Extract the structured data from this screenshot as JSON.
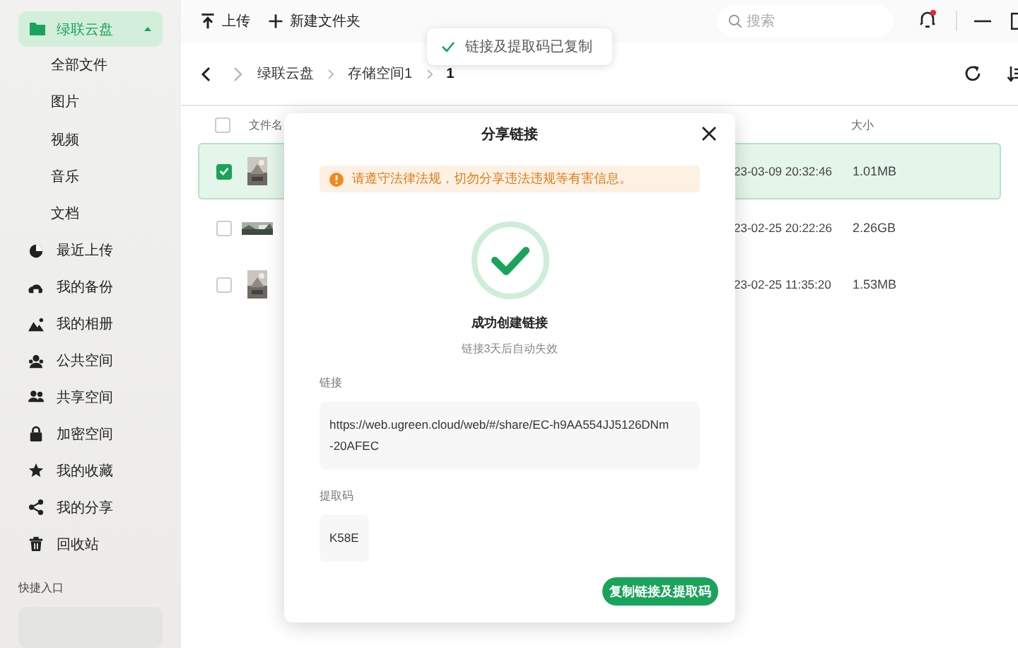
{
  "sidebar": {
    "items": [
      {
        "label": "绿联云盘",
        "kind": "group",
        "selected": true,
        "expanded": true,
        "children": [
          {
            "label": "全部文件",
            "selected": false
          },
          {
            "label": "图片",
            "selected": false
          },
          {
            "label": "视频",
            "selected": false
          },
          {
            "label": "音乐",
            "selected": false
          },
          {
            "label": "文档",
            "selected": false
          }
        ]
      },
      {
        "label": "最近上传",
        "kind": "item",
        "selected": false
      },
      {
        "label": "我的备份",
        "kind": "item",
        "selected": false
      },
      {
        "label": "我的相册",
        "kind": "item",
        "selected": false
      },
      {
        "label": "公共空间",
        "kind": "item",
        "selected": false
      },
      {
        "label": "共享空间",
        "kind": "item",
        "selected": false
      },
      {
        "label": "加密空间",
        "kind": "item",
        "selected": false
      },
      {
        "label": "我的收藏",
        "kind": "item",
        "selected": false
      },
      {
        "label": "我的分享",
        "kind": "item",
        "selected": false
      },
      {
        "label": "回收站",
        "kind": "item",
        "selected": false
      }
    ],
    "quick_access": {
      "title": "快捷入口"
    }
  },
  "toolbar": {
    "buttons": [
      {
        "label": "上传"
      },
      {
        "label": "新建文件夹"
      }
    ],
    "search": {
      "placeholder": "搜索"
    },
    "notifications": {
      "unread": true
    }
  },
  "breadcrumb": [
    "绿联云盘",
    "存储空间1",
    "1"
  ],
  "table": {
    "header": {
      "checked": false,
      "name": "文件名",
      "size": "大小"
    },
    "rows": [
      {
        "selected": true,
        "checked": true,
        "date": "23-03-09 20:32:46",
        "size": "1.01MB"
      },
      {
        "selected": false,
        "checked": false,
        "date": "23-02-25 20:22:26",
        "size": "2.26GB"
      },
      {
        "selected": false,
        "checked": false,
        "date": "23-02-25 11:35:20",
        "size": "1.53MB"
      }
    ]
  },
  "toast": "链接及提取码已复制",
  "dialog": {
    "title": "分享链接",
    "warning": "请遵守法律法规，切勿分享违法违规等有害信息。",
    "success_title": "成功创建链接",
    "success_subtitle": "链接3天后自动失效",
    "link_label": "链接",
    "link": "https://web.ugreen.cloud/web/#/share/EC-h9AA554JJ5126DNm\n-20AFEC",
    "code_label": "提取码",
    "code": "K58E",
    "button": "复制链接及提取码"
  }
}
